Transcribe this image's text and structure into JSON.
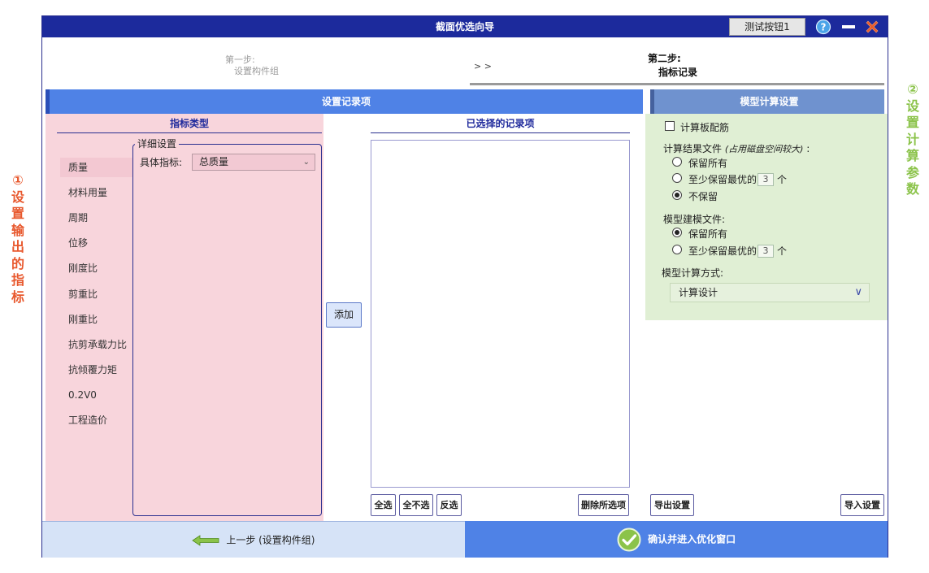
{
  "annotations": {
    "left": {
      "number": "①",
      "text": "设置输出的指标",
      "color": "#e8582d"
    },
    "right": {
      "number": "②",
      "text": "设置计算参数",
      "color": "#8bc34a"
    }
  },
  "window": {
    "title": "截面优选向导",
    "test_button": "测试按钮1",
    "help_icon": "help-icon",
    "minimize_icon": "minimize-icon",
    "close_icon": "close-icon"
  },
  "steps": {
    "step1_label": "第一步:",
    "step1_name": "设置构件组",
    "arrow": "> >",
    "step2_label": "第二步:",
    "step2_name": "指标记录"
  },
  "record_panel": {
    "header": "设置记录项",
    "indicator_type_title": "指标类型",
    "categories": [
      "质量",
      "材料用量",
      "周期",
      "位移",
      "刚度比",
      "剪重比",
      "刚重比",
      "抗剪承载力比",
      "抗倾覆力矩",
      "0.2V0",
      "工程造价"
    ],
    "selected_category": "质量",
    "detail_legend": "详细设置",
    "indicator_label": "具体指标:",
    "indicator_value": "总质量",
    "add_button": "添加",
    "selected_title": "已选择的记录项",
    "selected_items": [],
    "select_all": "全选",
    "select_none": "全不选",
    "invert": "反选",
    "delete_selected": "删除所选项"
  },
  "model_panel": {
    "header": "模型计算设置",
    "slab_reinforcement": {
      "label": "计算板配筋",
      "checked": false
    },
    "result_files_label": "计算结果文件",
    "result_files_note": "(占用磁盘空间较大)",
    "result_files_colon": ":",
    "result_options": [
      {
        "label": "保留所有",
        "selected": false
      },
      {
        "label": "至少保留最优的",
        "selected": false,
        "count": "3",
        "suffix": "个"
      },
      {
        "label": "不保留",
        "selected": true
      }
    ],
    "model_files_label": "模型建模文件:",
    "model_options": [
      {
        "label": "保留所有",
        "selected": true
      },
      {
        "label": "至少保留最优的",
        "selected": false,
        "count": "3",
        "suffix": "个"
      }
    ],
    "calc_method_label": "模型计算方式:",
    "calc_method_value": "计算设计",
    "export_button": "导出设置",
    "import_button": "导入设置"
  },
  "footer": {
    "prev_button": "上一步 (设置构件组)",
    "confirm_button": "确认并进入优化窗口"
  },
  "colors": {
    "titlebar": "#1c2a9c",
    "header_blue": "#4f82e6",
    "header_steel": "#6f92cf",
    "pink_panel": "#f8d5dc",
    "green_panel": "#e0efd4",
    "accent_green": "#8bc34a",
    "close_red": "#e85a2a"
  }
}
